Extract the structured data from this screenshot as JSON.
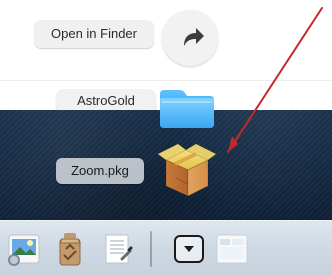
{
  "stack": {
    "open_in_finder_label": "Open in Finder",
    "items": [
      {
        "label": "AstroGold",
        "icon": "folder-icon"
      },
      {
        "label": "Zoom.pkg",
        "icon": "package-icon"
      }
    ]
  },
  "dock": {
    "items": [
      {
        "icon": "preview-icon"
      },
      {
        "icon": "recycle-icon"
      },
      {
        "icon": "notes-icon"
      },
      {
        "icon": "stack-toggle-icon"
      },
      {
        "icon": "window-thumbnail-icon"
      }
    ]
  },
  "colors": {
    "desktop_dark": "#122741",
    "dock_light": "#dfe7ef",
    "arrow_red": "#c62828",
    "folder_blue": "#3ba9f0"
  }
}
